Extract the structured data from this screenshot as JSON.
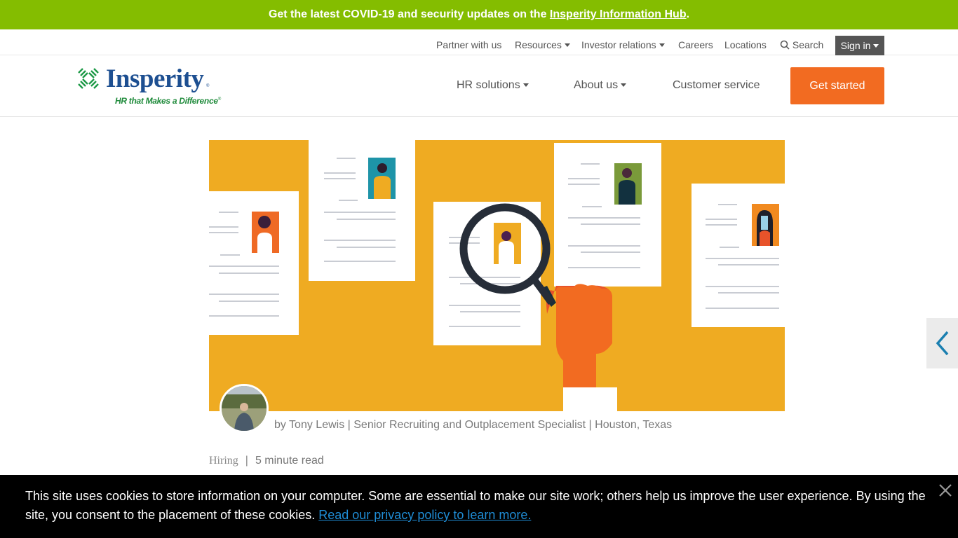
{
  "covid_banner": {
    "text": "Get the latest COVID-19 and security updates on the ",
    "link": "Insperity Information Hub",
    "suffix": "."
  },
  "utility_nav": {
    "items": [
      {
        "label": "Partner with us",
        "dropdown": false
      },
      {
        "label": "Resources",
        "dropdown": true
      },
      {
        "label": "Investor relations",
        "dropdown": true
      },
      {
        "label": "Careers",
        "dropdown": false
      },
      {
        "label": "Locations",
        "dropdown": false
      }
    ],
    "search_label": "Search",
    "signin_label": "Sign in"
  },
  "logo": {
    "name": "Insperity",
    "tagline": "HR that Makes a Difference",
    "brand_blue": "#1d4f91",
    "brand_green": "#1e8a3a"
  },
  "main_nav": {
    "items": [
      {
        "label": "HR solutions",
        "dropdown": true
      },
      {
        "label": "About us",
        "dropdown": true
      },
      {
        "label": "Customer service",
        "dropdown": false
      }
    ],
    "cta_label": "Get started",
    "cta_color": "#f26b21"
  },
  "hero": {
    "alt": "Illustration of hand holding magnifying glass over resumes",
    "background_color": "#efab22"
  },
  "article": {
    "byline": "by Tony Lewis | Senior Recruiting and Outplacement Specialist | Houston, Texas",
    "category": "Hiring",
    "separator": "|",
    "read_time": "5 minute read"
  },
  "cookie_banner": {
    "text": "This site uses cookies to store information on your computer. Some are essential to make our site work; others help us improve the user experience. By using the site, you consent to the placement of these cookies. ",
    "link": "Read our privacy policy to learn more."
  }
}
